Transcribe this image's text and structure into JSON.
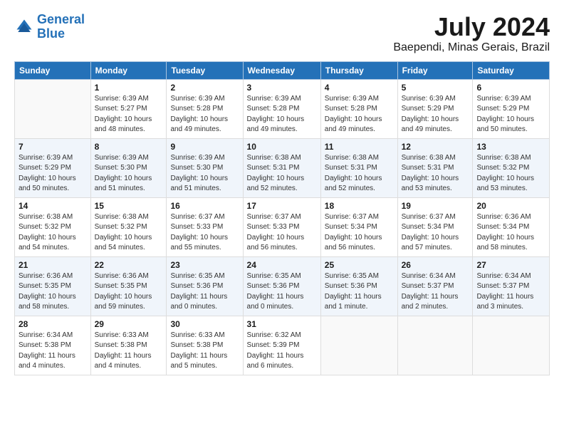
{
  "logo": {
    "line1": "General",
    "line2": "Blue"
  },
  "title": "July 2024",
  "subtitle": "Baependi, Minas Gerais, Brazil",
  "weekdays": [
    "Sunday",
    "Monday",
    "Tuesday",
    "Wednesday",
    "Thursday",
    "Friday",
    "Saturday"
  ],
  "weeks": [
    [
      {
        "day": "",
        "sunrise": "",
        "sunset": "",
        "daylight": ""
      },
      {
        "day": "1",
        "sunrise": "Sunrise: 6:39 AM",
        "sunset": "Sunset: 5:27 PM",
        "daylight": "Daylight: 10 hours and 48 minutes."
      },
      {
        "day": "2",
        "sunrise": "Sunrise: 6:39 AM",
        "sunset": "Sunset: 5:28 PM",
        "daylight": "Daylight: 10 hours and 49 minutes."
      },
      {
        "day": "3",
        "sunrise": "Sunrise: 6:39 AM",
        "sunset": "Sunset: 5:28 PM",
        "daylight": "Daylight: 10 hours and 49 minutes."
      },
      {
        "day": "4",
        "sunrise": "Sunrise: 6:39 AM",
        "sunset": "Sunset: 5:28 PM",
        "daylight": "Daylight: 10 hours and 49 minutes."
      },
      {
        "day": "5",
        "sunrise": "Sunrise: 6:39 AM",
        "sunset": "Sunset: 5:29 PM",
        "daylight": "Daylight: 10 hours and 49 minutes."
      },
      {
        "day": "6",
        "sunrise": "Sunrise: 6:39 AM",
        "sunset": "Sunset: 5:29 PM",
        "daylight": "Daylight: 10 hours and 50 minutes."
      }
    ],
    [
      {
        "day": "7",
        "sunrise": "Sunrise: 6:39 AM",
        "sunset": "Sunset: 5:29 PM",
        "daylight": "Daylight: 10 hours and 50 minutes."
      },
      {
        "day": "8",
        "sunrise": "Sunrise: 6:39 AM",
        "sunset": "Sunset: 5:30 PM",
        "daylight": "Daylight: 10 hours and 51 minutes."
      },
      {
        "day": "9",
        "sunrise": "Sunrise: 6:39 AM",
        "sunset": "Sunset: 5:30 PM",
        "daylight": "Daylight: 10 hours and 51 minutes."
      },
      {
        "day": "10",
        "sunrise": "Sunrise: 6:38 AM",
        "sunset": "Sunset: 5:31 PM",
        "daylight": "Daylight: 10 hours and 52 minutes."
      },
      {
        "day": "11",
        "sunrise": "Sunrise: 6:38 AM",
        "sunset": "Sunset: 5:31 PM",
        "daylight": "Daylight: 10 hours and 52 minutes."
      },
      {
        "day": "12",
        "sunrise": "Sunrise: 6:38 AM",
        "sunset": "Sunset: 5:31 PM",
        "daylight": "Daylight: 10 hours and 53 minutes."
      },
      {
        "day": "13",
        "sunrise": "Sunrise: 6:38 AM",
        "sunset": "Sunset: 5:32 PM",
        "daylight": "Daylight: 10 hours and 53 minutes."
      }
    ],
    [
      {
        "day": "14",
        "sunrise": "Sunrise: 6:38 AM",
        "sunset": "Sunset: 5:32 PM",
        "daylight": "Daylight: 10 hours and 54 minutes."
      },
      {
        "day": "15",
        "sunrise": "Sunrise: 6:38 AM",
        "sunset": "Sunset: 5:32 PM",
        "daylight": "Daylight: 10 hours and 54 minutes."
      },
      {
        "day": "16",
        "sunrise": "Sunrise: 6:37 AM",
        "sunset": "Sunset: 5:33 PM",
        "daylight": "Daylight: 10 hours and 55 minutes."
      },
      {
        "day": "17",
        "sunrise": "Sunrise: 6:37 AM",
        "sunset": "Sunset: 5:33 PM",
        "daylight": "Daylight: 10 hours and 56 minutes."
      },
      {
        "day": "18",
        "sunrise": "Sunrise: 6:37 AM",
        "sunset": "Sunset: 5:34 PM",
        "daylight": "Daylight: 10 hours and 56 minutes."
      },
      {
        "day": "19",
        "sunrise": "Sunrise: 6:37 AM",
        "sunset": "Sunset: 5:34 PM",
        "daylight": "Daylight: 10 hours and 57 minutes."
      },
      {
        "day": "20",
        "sunrise": "Sunrise: 6:36 AM",
        "sunset": "Sunset: 5:34 PM",
        "daylight": "Daylight: 10 hours and 58 minutes."
      }
    ],
    [
      {
        "day": "21",
        "sunrise": "Sunrise: 6:36 AM",
        "sunset": "Sunset: 5:35 PM",
        "daylight": "Daylight: 10 hours and 58 minutes."
      },
      {
        "day": "22",
        "sunrise": "Sunrise: 6:36 AM",
        "sunset": "Sunset: 5:35 PM",
        "daylight": "Daylight: 10 hours and 59 minutes."
      },
      {
        "day": "23",
        "sunrise": "Sunrise: 6:35 AM",
        "sunset": "Sunset: 5:36 PM",
        "daylight": "Daylight: 11 hours and 0 minutes."
      },
      {
        "day": "24",
        "sunrise": "Sunrise: 6:35 AM",
        "sunset": "Sunset: 5:36 PM",
        "daylight": "Daylight: 11 hours and 0 minutes."
      },
      {
        "day": "25",
        "sunrise": "Sunrise: 6:35 AM",
        "sunset": "Sunset: 5:36 PM",
        "daylight": "Daylight: 11 hours and 1 minute."
      },
      {
        "day": "26",
        "sunrise": "Sunrise: 6:34 AM",
        "sunset": "Sunset: 5:37 PM",
        "daylight": "Daylight: 11 hours and 2 minutes."
      },
      {
        "day": "27",
        "sunrise": "Sunrise: 6:34 AM",
        "sunset": "Sunset: 5:37 PM",
        "daylight": "Daylight: 11 hours and 3 minutes."
      }
    ],
    [
      {
        "day": "28",
        "sunrise": "Sunrise: 6:34 AM",
        "sunset": "Sunset: 5:38 PM",
        "daylight": "Daylight: 11 hours and 4 minutes."
      },
      {
        "day": "29",
        "sunrise": "Sunrise: 6:33 AM",
        "sunset": "Sunset: 5:38 PM",
        "daylight": "Daylight: 11 hours and 4 minutes."
      },
      {
        "day": "30",
        "sunrise": "Sunrise: 6:33 AM",
        "sunset": "Sunset: 5:38 PM",
        "daylight": "Daylight: 11 hours and 5 minutes."
      },
      {
        "day": "31",
        "sunrise": "Sunrise: 6:32 AM",
        "sunset": "Sunset: 5:39 PM",
        "daylight": "Daylight: 11 hours and 6 minutes."
      },
      {
        "day": "",
        "sunrise": "",
        "sunset": "",
        "daylight": ""
      },
      {
        "day": "",
        "sunrise": "",
        "sunset": "",
        "daylight": ""
      },
      {
        "day": "",
        "sunrise": "",
        "sunset": "",
        "daylight": ""
      }
    ]
  ]
}
